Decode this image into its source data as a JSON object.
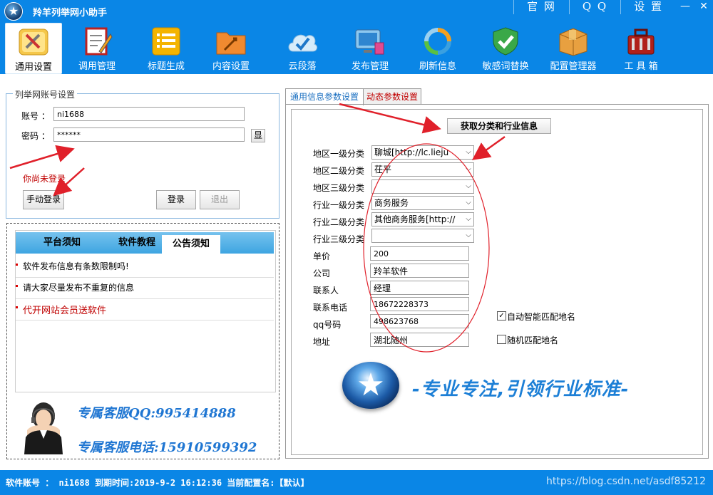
{
  "window": {
    "title": "羚羊列举网小助手"
  },
  "title_links": [
    "官 网",
    "Q Q",
    "设 置"
  ],
  "title_buttons": {
    "minimize": "—",
    "close": "✕"
  },
  "toolbar": [
    {
      "label": "通用设置",
      "icon": "tools-icon",
      "active": true
    },
    {
      "label": "调用管理",
      "icon": "clipboard-pen-icon"
    },
    {
      "label": "标题生成",
      "icon": "list-icon"
    },
    {
      "label": "内容设置",
      "icon": "folder-icon"
    },
    {
      "label": "云段落",
      "icon": "cloud-check-icon"
    },
    {
      "label": "发布管理",
      "icon": "monitor-icon"
    },
    {
      "label": "刷新信息",
      "icon": "refresh-icon"
    },
    {
      "label": "敏感词替换",
      "icon": "shield-check-icon"
    },
    {
      "label": "配置管理器",
      "icon": "box-icon"
    },
    {
      "label": "工 具 箱",
      "icon": "toolbox-icon"
    }
  ],
  "account": {
    "legend": "列举网账号设置",
    "username_label": "账号 ：",
    "username_value": "ni1688",
    "password_label": "密码 ：",
    "password_value": "******",
    "show_button": "显",
    "status": "你尚未登录",
    "manual_login": "手动登录",
    "login": "登录",
    "logout": "退出"
  },
  "notices": {
    "tabs": [
      "平台须知",
      "软件教程",
      "公告须知"
    ],
    "active_tab": 2,
    "items": [
      "软件发布信息有条数限制吗!",
      "请大家尽量发布不重复的信息",
      "代开网站会员送软件"
    ]
  },
  "service": {
    "qq": "专属客服QQ:995414888",
    "phone": "专属客服电话:15910599392"
  },
  "params": {
    "tabs": [
      "通用信息参数设置",
      "动态参数设置"
    ],
    "fetch_button": "获取分类和行业信息",
    "fields": [
      {
        "label": "地区一级分类",
        "value": "聊城[http://lc.lieju",
        "type": "select"
      },
      {
        "label": "地区二级分类",
        "value": "茌平",
        "type": "select"
      },
      {
        "label": "地区三级分类",
        "value": "",
        "type": "select"
      },
      {
        "label": "行业一级分类",
        "value": "商务服务",
        "type": "select"
      },
      {
        "label": "行业二级分类",
        "value": "其他商务服务[http://",
        "type": "select"
      },
      {
        "label": "行业三级分类",
        "value": "",
        "type": "select"
      },
      {
        "label": "单价",
        "value": "200",
        "type": "input"
      },
      {
        "label": "公司",
        "value": "羚羊软件",
        "type": "input"
      },
      {
        "label": "联系人",
        "value": "经理",
        "type": "input"
      },
      {
        "label": "联系电话",
        "value": "18672228373",
        "type": "input"
      },
      {
        "label": "qq号码",
        "value": "498623768",
        "type": "input"
      },
      {
        "label": "地址",
        "value": "湖北随州",
        "type": "input"
      }
    ],
    "auto_match": {
      "label": "自动智能匹配地名",
      "checked": true
    },
    "random_match": {
      "label": "随机匹配地名",
      "checked": false
    },
    "slogan": "-专业专注,引领行业标准-"
  },
  "statusbar": {
    "text": "软件账号 ： ni1688  到期时间:2019-9-2 16:12:36  当前配置名:【默认】",
    "watermark": "https://blog.csdn.net/asdf85212"
  },
  "colors": {
    "accent": "#0a86e6",
    "red": "#c00000",
    "annotation": "#e0202a"
  }
}
